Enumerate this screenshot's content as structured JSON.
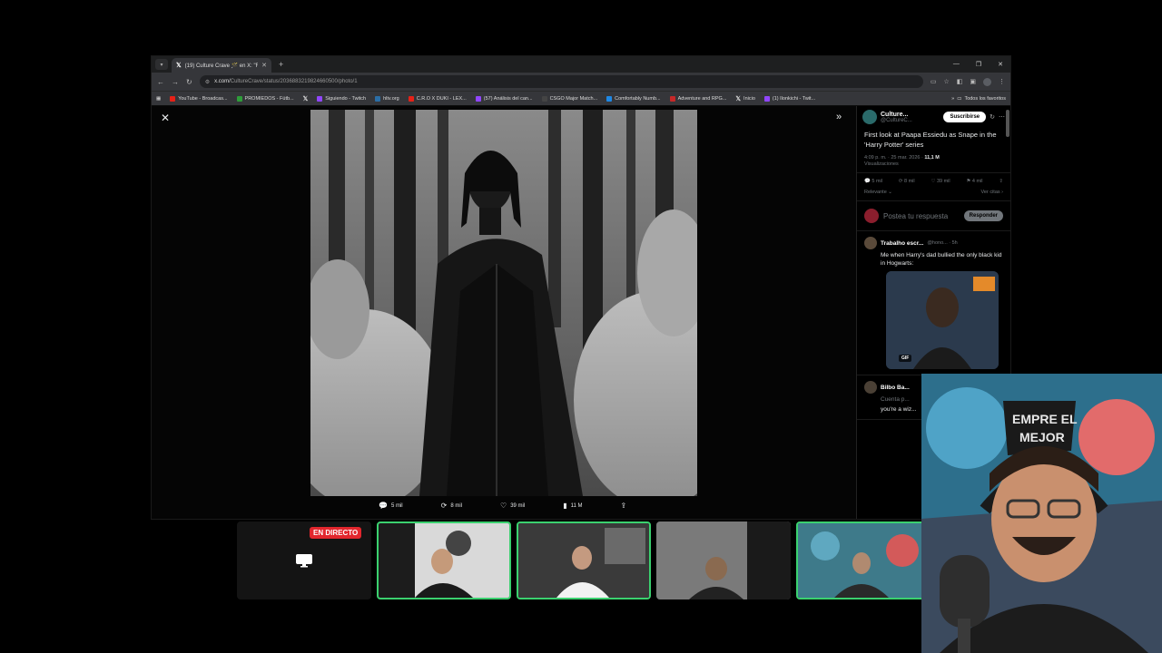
{
  "browser": {
    "tab_title": "(19) Culture Crave 🪄 en X: \"Fi",
    "new_tab": "+",
    "url_host": "x.com/",
    "url_path": "CultureCrave/status/2036883219824660500/photo/1",
    "bookmarks": [
      {
        "label": "YouTube - Broadcas...",
        "color": "#e62117"
      },
      {
        "label": "PROMIEDOS - Fútb...",
        "color": "#2e9d3a"
      },
      {
        "label": "",
        "color": "#000000",
        "x": true
      },
      {
        "label": "Siguiendo - Twitch",
        "color": "#9146ff"
      },
      {
        "label": "hltv.org",
        "color": "#2b6ea6"
      },
      {
        "label": "C.R.O X DUKI - LEX...",
        "color": "#e62117"
      },
      {
        "label": "(57) Análisis del can...",
        "color": "#9146ff"
      },
      {
        "label": "CSGO Major Match...",
        "color": "#444444"
      },
      {
        "label": "Comfortably Numb...",
        "color": "#1e88e5"
      },
      {
        "label": "Adventure and RPG...",
        "color": "#c62828"
      },
      {
        "label": "Inicio",
        "color": "#000000",
        "x": true
      },
      {
        "label": "(1) Ilonkichi - Twit...",
        "color": "#9146ff"
      }
    ],
    "all_bookmarks": "Todos los favoritos"
  },
  "photo_actions": {
    "replies": "5 mil",
    "reposts": "8 mil",
    "likes": "39 mil",
    "views": "11 M"
  },
  "post": {
    "author_name": "Culture...",
    "author_handle": "@CultureC...",
    "subscribe_label": "Suscribirse",
    "text": "First look at Paapa Essiedu as Snape in the 'Harry Potter' series",
    "time": "4:09 p. m. · 25 mar. 2026 · ",
    "views_count": "11,1 M",
    "views_label": "Visualizaciones",
    "stats": {
      "replies": "5 mil",
      "reposts": "8 mil",
      "likes": "39 mil",
      "bookmarks": "4 mil"
    },
    "sort_label": "Relevante",
    "quotes_label": "Ver citas",
    "reply_placeholder": "Postea tu respuesta",
    "reply_button": "Responder"
  },
  "replies": [
    {
      "name": "Trabalho escr...",
      "handle": "@hono... · 5h",
      "text": "Me when Harry's dad bullied the only black kid in Hogwarts:",
      "gif_label": "GIF"
    },
    {
      "name": "Bilbo Ba...",
      "handle": "Cuenta p...",
      "text": "you're a wiz..."
    }
  ],
  "stream": {
    "live_label": "EN DIRECTO"
  },
  "colors": {
    "live_red": "#e2262d",
    "active_green": "#3bd16f",
    "x_black": "#000000"
  }
}
